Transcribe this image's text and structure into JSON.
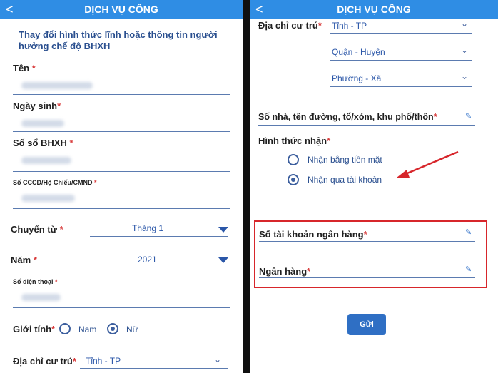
{
  "left": {
    "header_title": "DỊCH VỤ CÔNG",
    "back_glyph": "<",
    "title_line1": "Thay đổi hình thức lĩnh hoặc thông tin người",
    "title_line2": "hưởng chế độ BHXH",
    "fields": {
      "ten": "Tên",
      "ngay_sinh": "Ngày sinh",
      "so_so_bhxh": "Số sổ BHXH",
      "cccd": "Số CCCD/Hộ Chiếu/CMND",
      "chuyen_tu": "Chuyển từ",
      "chuyen_tu_value": "Tháng 1",
      "nam": "Năm",
      "nam_value": "2021",
      "so_dien_thoai": "Số điện thoại",
      "gioi_tinh": "Giới tính",
      "gioi_tinh_options": [
        "Nam",
        "Nữ"
      ],
      "gioi_tinh_selected": "Nữ",
      "dia_chi": "Địa chỉ cư trú",
      "tinh_value": "Tỉnh - TP"
    },
    "required_mark": "*"
  },
  "right": {
    "header_title": "DỊCH VỤ CÔNG",
    "back_glyph": "<",
    "dia_chi": "Địa chỉ cư trú",
    "tinh_value": "Tỉnh - TP",
    "quan_value": "Quận - Huyện",
    "phuong_value": "Phường - Xã",
    "so_nha": "Số nhà, tên đường, tổ/xóm, khu phố/thôn",
    "hinh_thuc_nhan": "Hình thức nhận",
    "options": [
      "Nhận bằng tiền mặt",
      "Nhận qua tài khoản"
    ],
    "selected_option": "Nhận qua tài khoản",
    "so_tai_khoan": "Số tài khoản ngân hàng",
    "ngan_hang": "Ngân hàng",
    "submit_label": "Gửi",
    "required_mark": "*"
  },
  "colors": {
    "header": "#2f8de4",
    "highlight_box": "#d7262b",
    "arrow": "#d7262b",
    "accent_text": "#2a4f8f"
  },
  "icons": [
    "chevron-left-icon",
    "dropdown-triangle-icon",
    "chevron-down-icon",
    "pencil-icon",
    "red-arrow-annotation"
  ]
}
